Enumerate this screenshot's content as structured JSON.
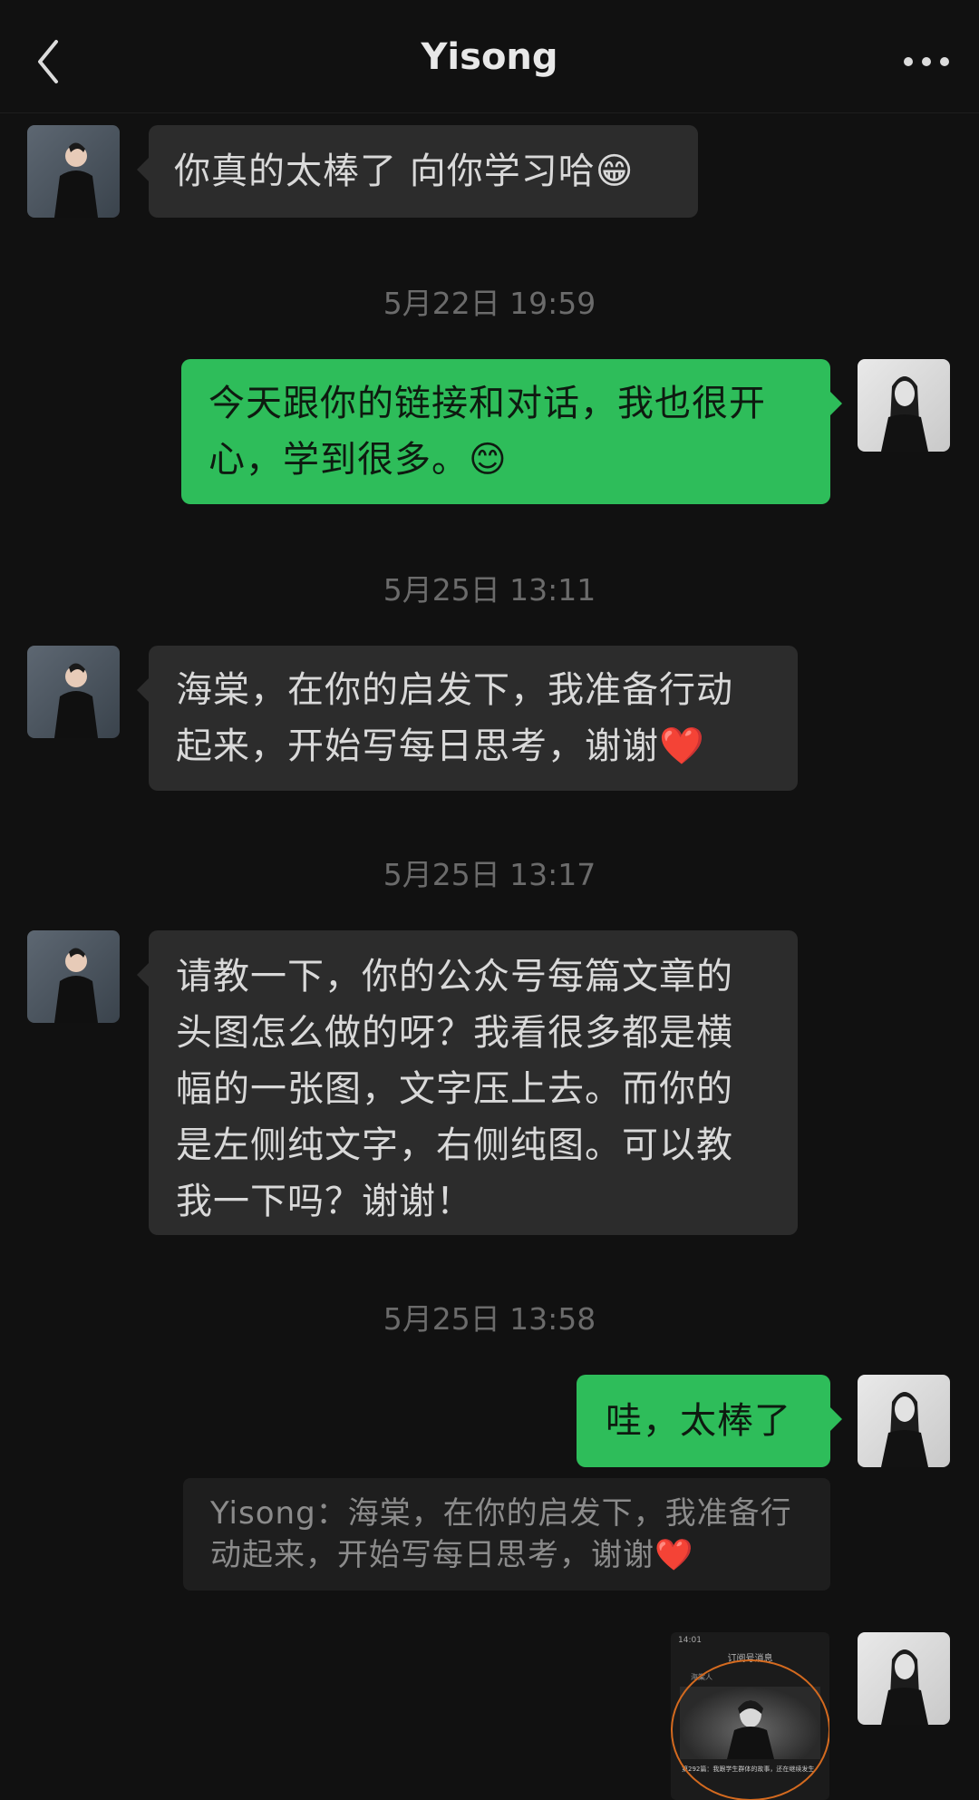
{
  "header": {
    "title": "Yisong",
    "back_icon": "chevron-left-icon",
    "more_icon": "more-dots-icon"
  },
  "messages": [
    {
      "text": "你真的太棒了 向你学习哈😁"
    },
    {
      "timestamp": "5月22日 19:59"
    },
    {
      "text_line1": "今天跟你的链接和对话，我也很开",
      "text_line2": "心，学到很多。😊"
    },
    {
      "timestamp": "5月25日 13:11"
    },
    {
      "text_line1": "海棠，在你的启发下，我准备行动",
      "text_line2": "起来，开始写每日思考，谢谢❤️"
    },
    {
      "timestamp": "5月25日 13:17"
    },
    {
      "lines": [
        "请教一下，你的公众号每篇文章的",
        "头图怎么做的呀？我看很多都是横",
        "幅的一张图，文字压上去。而你的",
        "是左侧纯文字，右侧纯图。可以教",
        "我一下吗？谢谢！"
      ]
    },
    {
      "timestamp": "5月25日 13:58"
    },
    {
      "text": "哇，太棒了"
    },
    {
      "quote_line1": "Yisong：海棠，在你的启发下，我准备行",
      "quote_line2": "动起来，开始写每日思考，谢谢❤️"
    },
    {
      "screenshot": {
        "status": "14:01",
        "title": "订阅号消息",
        "account": "海棠人",
        "caption": "第292篇：我跟学生群体的故事，还在继续发生"
      }
    }
  ]
}
